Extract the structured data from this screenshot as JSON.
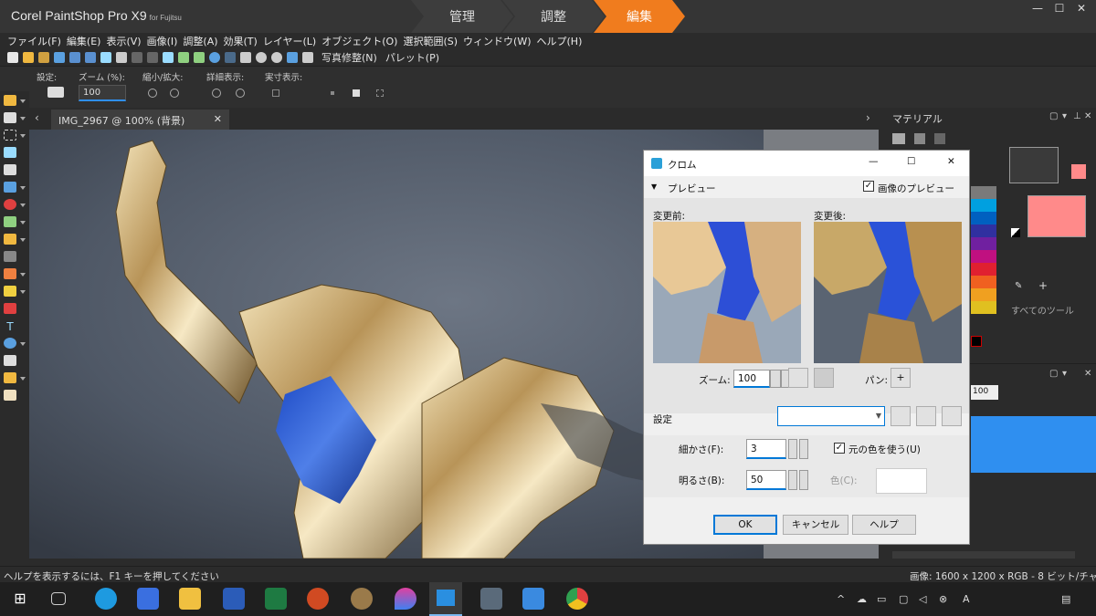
{
  "app": {
    "title": "Corel PaintShop Pro X9",
    "subtitle": "for Fujitsu",
    "workspace_tabs": [
      {
        "label": "管理"
      },
      {
        "label": "調整"
      },
      {
        "label": "編集"
      }
    ],
    "window_controls": {
      "minimize": "—",
      "maximize": "☐",
      "close": "✕"
    }
  },
  "menu": [
    "ファイル(F)",
    "編集(E)",
    "表示(V)",
    "画像(I)",
    "調整(A)",
    "効果(T)",
    "レイヤー(L)",
    "オブジェクト(O)",
    "選択範囲(S)",
    "ウィンドウ(W)",
    "ヘルプ(H)"
  ],
  "toolbar": {
    "photo_fix": "写真修整(N)",
    "palette": "パレット(P)"
  },
  "tool_options": {
    "preset_label": "設定:",
    "zoom_label": "ズーム (%):",
    "zoom_value": "100",
    "zoom_in_out_label": "縮小/拡大:",
    "detail_label": "詳細表示:",
    "actual_label": "実寸表示:"
  },
  "document": {
    "tab_label": "IMG_2967 @ 100% (背景)",
    "close": "✕"
  },
  "right_panel": {
    "materials_title": "マテリアル",
    "all_tools": "すべてのツール",
    "layer_opacity": "100"
  },
  "dialog": {
    "title": "クロム",
    "preview_section": "プレビュー",
    "image_preview": "画像のプレビュー",
    "image_preview_checked": true,
    "before_label": "変更前:",
    "after_label": "変更後:",
    "zoom_label": "ズーム:",
    "zoom_value": "100",
    "pan_label": "パン:",
    "settings_label": "設定",
    "settings_value": "",
    "detail_label": "細かさ(F):",
    "detail_value": "3",
    "use_original_color": "元の色を使う(U)",
    "use_original_checked": true,
    "brightness_label": "明るさ(B):",
    "brightness_value": "50",
    "color_label": "色(C):",
    "ok": "OK",
    "cancel": "キャンセル",
    "help": "ヘルプ",
    "window_controls": {
      "minimize": "—",
      "maximize": "☐",
      "close": "✕"
    }
  },
  "status": {
    "help_hint": "ヘルプを表示するには、F1 キーを押してください",
    "image_info": "画像:  1600 x 1200 x RGB - 8 ビット/チャネル"
  },
  "colors": {
    "accent": "#f07c1e",
    "foreground_swatch": "#3a3a3a",
    "background_swatch": "#ff8a8a",
    "selection_blue": "#2f8ff0"
  },
  "taskbar_apps": [
    "start-icon",
    "task-view-icon",
    "edge-icon",
    "mail-app-icon",
    "file-explorer-icon",
    "word-icon",
    "excel-icon",
    "powerpoint-icon",
    "paint-icon",
    "drop-icon",
    "paintshop-icon",
    "calculator-icon",
    "mail-icon",
    "chrome-icon"
  ]
}
